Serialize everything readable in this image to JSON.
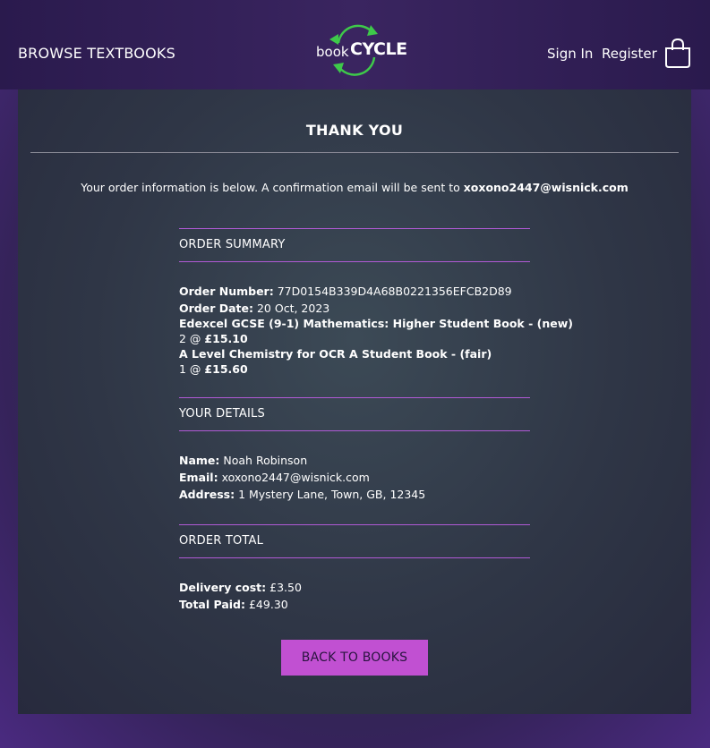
{
  "header": {
    "browse_label": "BROWSE TEXTBOOKS",
    "logo_book": "book",
    "logo_cycle": "CYCLE",
    "sign_in": "Sign In",
    "register": "Register",
    "cart_icon": "shopping-bag-icon"
  },
  "page": {
    "title": "THANK YOU",
    "intro_prefix": "Your order information is below. A confirmation email will be sent to ",
    "intro_email": "xoxono2447@wisnick.com"
  },
  "order_summary": {
    "heading": "ORDER SUMMARY",
    "order_number_label": "Order Number:",
    "order_number": "77D0154B339D4A68B0221356EFCB2D89",
    "order_date_label": "Order Date:",
    "order_date": "20 Oct, 2023",
    "items": [
      {
        "title": "Edexcel GCSE (9-1) Mathematics: Higher Student Book - (new)",
        "qty": "2 @",
        "price": "£15.10"
      },
      {
        "title": "A Level Chemistry for OCR A Student Book - (fair)",
        "qty": "1 @",
        "price": "£15.60"
      }
    ]
  },
  "details": {
    "heading": "YOUR DETAILS",
    "name_label": "Name:",
    "name": "Noah Robinson",
    "email_label": "Email:",
    "email": "xoxono2447@wisnick.com",
    "address_label": "Address:",
    "address": "1 Mystery Lane, Town, GB, 12345"
  },
  "total": {
    "heading": "ORDER TOTAL",
    "delivery_label": "Delivery cost:",
    "delivery": "£3.50",
    "paid_label": "Total Paid:",
    "paid": "£49.30"
  },
  "actions": {
    "back_label": "BACK TO BOOKS"
  },
  "colors": {
    "accent": "#c150d2",
    "rule": "#b15ad6",
    "logo_arrows": "#3ec94a"
  }
}
